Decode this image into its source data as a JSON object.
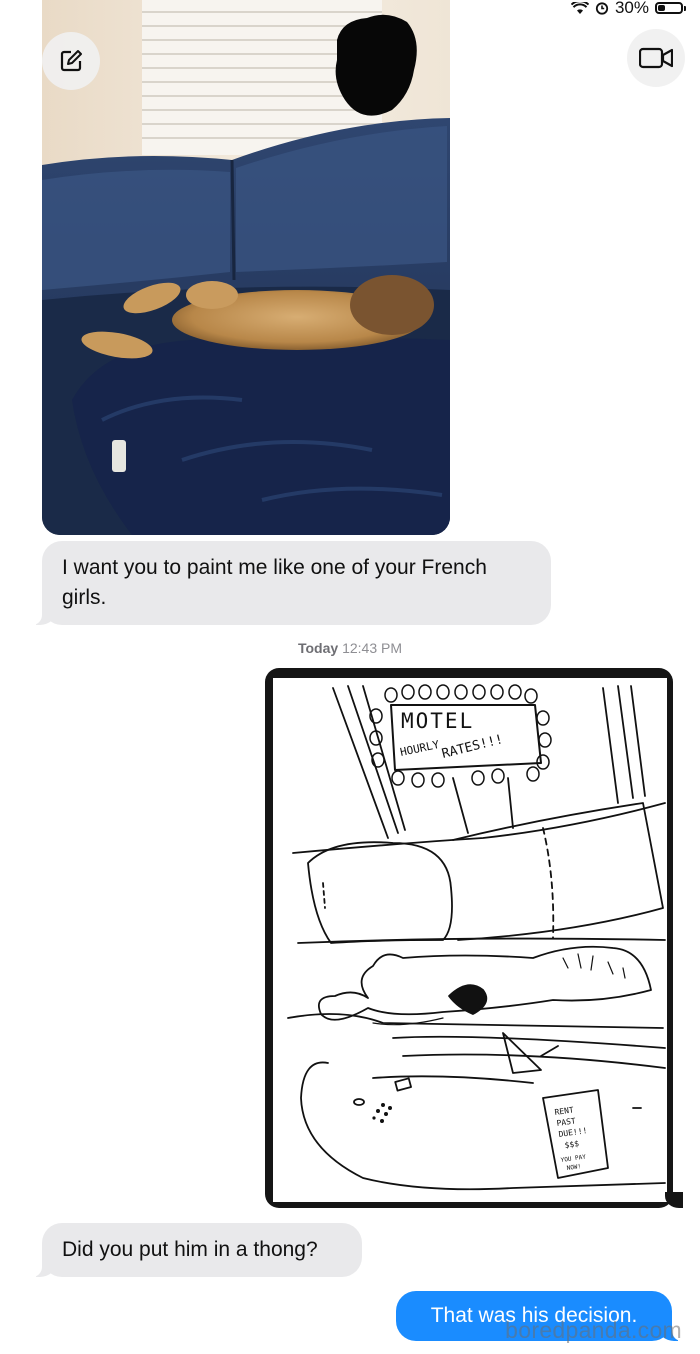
{
  "status": {
    "battery_text": "30%",
    "battery_level": 0.3
  },
  "header": {
    "compose_icon": "compose-icon",
    "video_icon": "video-call-icon"
  },
  "messages": {
    "first_text": "I want you to paint me like one of your French girls.",
    "timestamp_day": "Today",
    "timestamp_time": "12:43 PM",
    "reply_question": "Did you put him in a thong?",
    "reply_answer": "That was his decision."
  },
  "drawing": {
    "sign_title": "MOTEL",
    "sign_line1": "HOURLY",
    "sign_line2": "RATES!!!",
    "note_line1": "RENT",
    "note_line2": "PAST",
    "note_line3": "DUE!!!",
    "note_line4": "$$$",
    "note_line5": "YOU PAY",
    "note_line6": "NOW!"
  },
  "watermark": {
    "text": "boredpanda.com"
  }
}
